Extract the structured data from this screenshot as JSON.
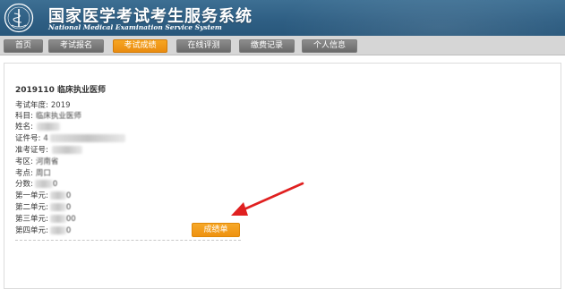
{
  "header": {
    "title": "国家医学考试考生服务系统",
    "subtitle": "National Medical Examination Service System",
    "logo_icon": "medical-emblem-icon"
  },
  "nav": {
    "tabs": [
      {
        "label": "首页",
        "active": false
      },
      {
        "label": "考试报名",
        "active": false
      },
      {
        "label": "考试成绩",
        "active": true
      },
      {
        "label": "在线评测",
        "active": false
      },
      {
        "label": "缴费记录",
        "active": false
      },
      {
        "label": "个人信息",
        "active": false
      }
    ]
  },
  "exam": {
    "heading": "2019110  临床执业医师",
    "fields": [
      {
        "label": "考试年度:",
        "value": "2019"
      },
      {
        "label": "科目:",
        "value": "临床执业医师"
      },
      {
        "label": "姓名:",
        "value": ""
      },
      {
        "label": "证件号:",
        "value": "4"
      },
      {
        "label": "准考证号:",
        "value": ""
      },
      {
        "label": "考区:",
        "value": "河南省"
      },
      {
        "label": "考点:",
        "value": "周口"
      },
      {
        "label": "分数:",
        "value": "0"
      },
      {
        "label": "第一单元:",
        "value": "0"
      },
      {
        "label": "第二单元:",
        "value": "0"
      },
      {
        "label": "第三单元:",
        "value": "00"
      },
      {
        "label": "第四单元:",
        "value": "0"
      }
    ]
  },
  "actions": {
    "transcript_label": "成绩单"
  },
  "colors": {
    "header_bg": "#2f5f84",
    "nav_bg": "#d6d6d6",
    "tab_gray": "#7a7a7a",
    "tab_active": "#f29a1a",
    "annotation_arrow": "#e02020"
  }
}
